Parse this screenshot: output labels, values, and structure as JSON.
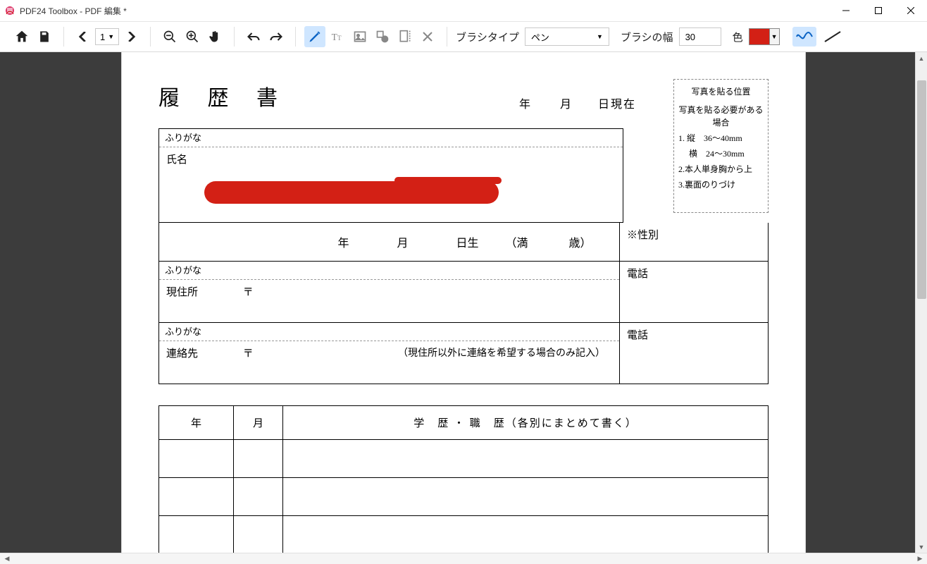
{
  "window": {
    "title": "PDF24 Toolbox - PDF 編集 *"
  },
  "toolbar": {
    "page_current": "1",
    "brush_type_label": "ブラシタイプ",
    "brush_type_value": "ペン",
    "brush_width_label": "ブラシの幅",
    "brush_width_value": "30",
    "color_label": "色",
    "color_value": "#d32015"
  },
  "doc": {
    "title": "履 歴 書",
    "date_year": "年",
    "date_month": "月",
    "date_day_current": "日現在",
    "photo_header": "写真を貼る位置",
    "photo_need": "写真を貼る必要がある場合",
    "photo_l1": "1. 縦　36～40mm",
    "photo_l1b": "　 横　24～30mm",
    "photo_l2": "2.本人単身胸から上",
    "photo_l3": "3.裏面のりづけ",
    "furigana": "ふりがな",
    "name_label": "氏名",
    "dob_year": "年",
    "dob_month": "月",
    "dob_day_born": "日生",
    "dob_full_age_open": "（満",
    "dob_full_age_unit": "歳）",
    "gender_label": "※性別",
    "addr_label": "現住所",
    "post_mark": "〒",
    "phone_label": "電話",
    "contact_label": "連絡先",
    "contact_note": "（現住所以外に連絡を希望する場合のみ記入）",
    "hist_year": "年",
    "hist_month": "月",
    "hist_header": "学　歴 ・ 職　歴（各別にまとめて書く）"
  }
}
